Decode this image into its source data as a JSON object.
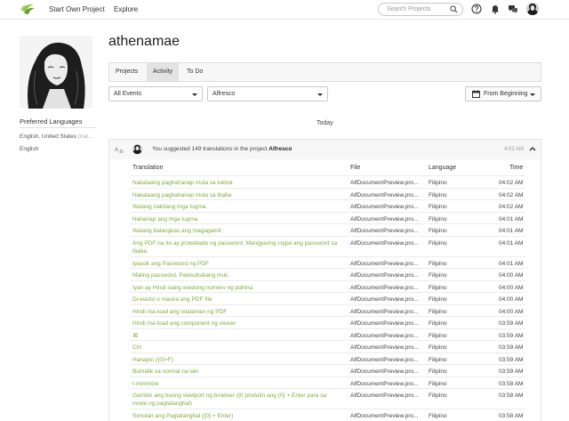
{
  "nav": {
    "logo_icon": "crowdin-logo-icon",
    "start_project": "Start Own Project",
    "explore": "Explore",
    "search_placeholder": "Search Projects",
    "icons": [
      "help-icon",
      "bell-icon",
      "messages-icon"
    ]
  },
  "profile": {
    "username": "athenamae",
    "preferred_languages_title": "Preferred Languages",
    "languages": [
      {
        "name": "English, United States",
        "note": "(nat..."
      },
      {
        "name": "English",
        "note": ""
      }
    ]
  },
  "tabs": [
    {
      "label": "Projects",
      "active": false
    },
    {
      "label": "Activity",
      "active": true
    },
    {
      "label": "To Do",
      "active": false
    }
  ],
  "filters": {
    "events": "All Events",
    "project": "Alfresco",
    "range": "From Beginning"
  },
  "day_label": "Today",
  "event": {
    "text_prefix": "You suggested 149 translations in the project ",
    "project": "Alfresco",
    "time": "4:02 AM"
  },
  "table": {
    "headers": [
      "Translation",
      "File",
      "Language",
      "Time"
    ],
    "rows": [
      {
        "translation": "Nakalaang paghahanap mula sa tuktok",
        "file": "AlfDocumentPreview.pro...",
        "language": "Filipino",
        "time": "04:02 AM"
      },
      {
        "translation": "Nakalaang paghahanap mula sa ibaba",
        "file": "AlfDocumentPreview.pro...",
        "language": "Filipino",
        "time": "04:02 AM"
      },
      {
        "translation": "Walang nakitang mga tugma",
        "file": "AlfDocumentPreview.pro...",
        "language": "Filipino",
        "time": "04:02 AM"
      },
      {
        "translation": "Nahanap ang mga tugma",
        "file": "AlfDocumentPreview.pro...",
        "language": "Filipino",
        "time": "04:01 AM"
      },
      {
        "translation": "Walang balangkas ang magagamit",
        "file": "AlfDocumentPreview.pro...",
        "language": "Filipino",
        "time": "04:01 AM"
      },
      {
        "translation": "Ang PDF na ito ay protektado ng password. Mangyaring i-type ang password sa ibaba.",
        "file": "AlfDocumentPreview.pro...",
        "language": "Filipino",
        "time": "04:01 AM"
      },
      {
        "translation": "Ipasok ang Password ng PDF",
        "file": "AlfDocumentPreview.pro...",
        "language": "Filipino",
        "time": "04:01 AM"
      },
      {
        "translation": "Maling password. Pakisubukang muli.",
        "file": "AlfDocumentPreview.pro...",
        "language": "Filipino",
        "time": "04:00 AM"
      },
      {
        "translation": "Iyan ay Hindi isang wastong numero ng pahina",
        "file": "AlfDocumentPreview.pro...",
        "language": "Filipino",
        "time": "04:00 AM"
      },
      {
        "translation": "Di-wasto o masira ang PDF file",
        "file": "AlfDocumentPreview.pro...",
        "language": "Filipino",
        "time": "04:00 AM"
      },
      {
        "translation": "Hindi ma-load ang nilalaman ng PDF",
        "file": "AlfDocumentPreview.pro...",
        "language": "Filipino",
        "time": "04:00 AM"
      },
      {
        "translation": "Hindi ma-load ang component ng viewer",
        "file": "AlfDocumentPreview.pro...",
        "language": "Filipino",
        "time": "03:59 AM"
      },
      {
        "translation": "⌘",
        "file": "AlfDocumentPreview.pro...",
        "language": "Filipino",
        "time": "03:59 AM"
      },
      {
        "translation": "Ctrl",
        "file": "AlfDocumentPreview.pro...",
        "language": "Filipino",
        "time": "03:59 AM"
      },
      {
        "translation": "Hanapin ({0}+F)",
        "file": "AlfDocumentPreview.pro...",
        "language": "Filipino",
        "time": "03:59 AM"
      },
      {
        "translation": "Bumalik sa normal na laki",
        "file": "AlfDocumentPreview.pro...",
        "language": "Filipino",
        "time": "03:59 AM"
      },
      {
        "translation": "I-minimize",
        "file": "AlfDocumentPreview.pro...",
        "language": "Filipino",
        "time": "03:58 AM"
      },
      {
        "translation": "Gamitin ang buong viewport ng browser ({0 pindutin ang {0} + Enter para sa mode ng pagtatanghal)",
        "file": "AlfDocumentPreview.pro...",
        "language": "Filipino",
        "time": "03:58 AM"
      },
      {
        "translation": "Simulan ang Pagtatanghal ({0} + Enter)",
        "file": "AlfDocumentPreview.pro...",
        "language": "Filipino",
        "time": "03:58 AM"
      }
    ]
  },
  "colors": {
    "link_green": "#7fad3a",
    "tab_active_bg": "#e3e3e3"
  }
}
